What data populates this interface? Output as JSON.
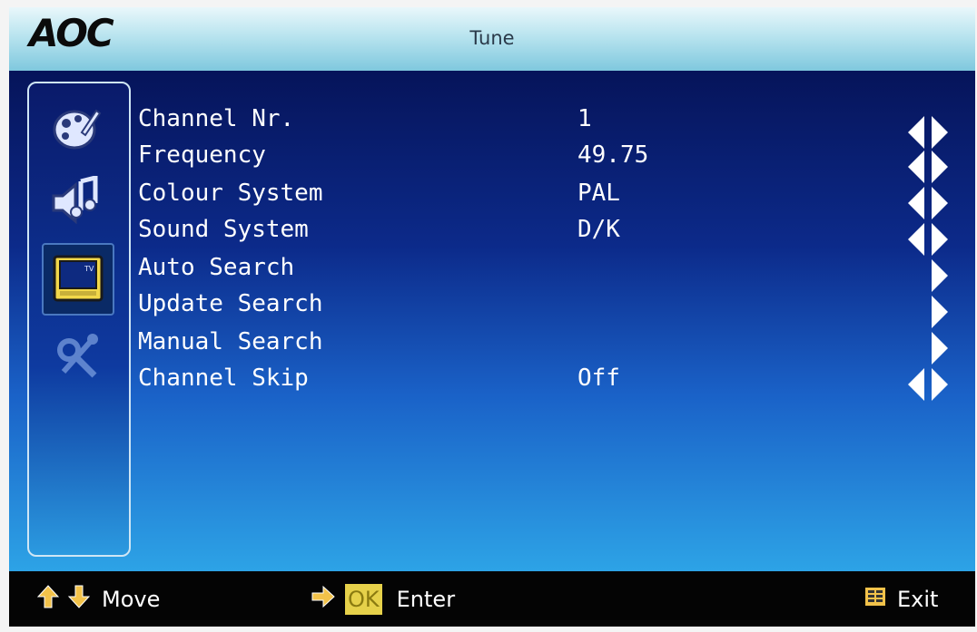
{
  "header": {
    "logo": "AOC",
    "title": "Tune"
  },
  "sidebar": {
    "icons": [
      {
        "name": "picture-palette-icon",
        "selected": false
      },
      {
        "name": "sound-icon",
        "selected": false
      },
      {
        "name": "tv-icon",
        "selected": true
      },
      {
        "name": "tools-icon",
        "selected": false
      }
    ]
  },
  "menu": {
    "items": [
      {
        "label": "Channel Nr.",
        "value": "1",
        "arrows": "both"
      },
      {
        "label": "Frequency",
        "value": "49.75",
        "arrows": "both"
      },
      {
        "label": "Colour System",
        "value": "PAL",
        "arrows": "both"
      },
      {
        "label": "Sound System",
        "value": "D/K",
        "arrows": "both"
      },
      {
        "label": "Auto Search",
        "value": "",
        "arrows": "right"
      },
      {
        "label": "Update Search",
        "value": "",
        "arrows": "right"
      },
      {
        "label": "Manual Search",
        "value": "",
        "arrows": "right"
      },
      {
        "label": "Channel Skip",
        "value": "Off",
        "arrows": "both"
      }
    ]
  },
  "footer": {
    "move_label": "Move",
    "ok_label": "OK",
    "enter_label": "Enter",
    "exit_label": "Exit"
  },
  "colors": {
    "arrow": "#ffffff",
    "ok_badge": "#e6d14a",
    "up_down_arrow": "#f2c24a"
  }
}
